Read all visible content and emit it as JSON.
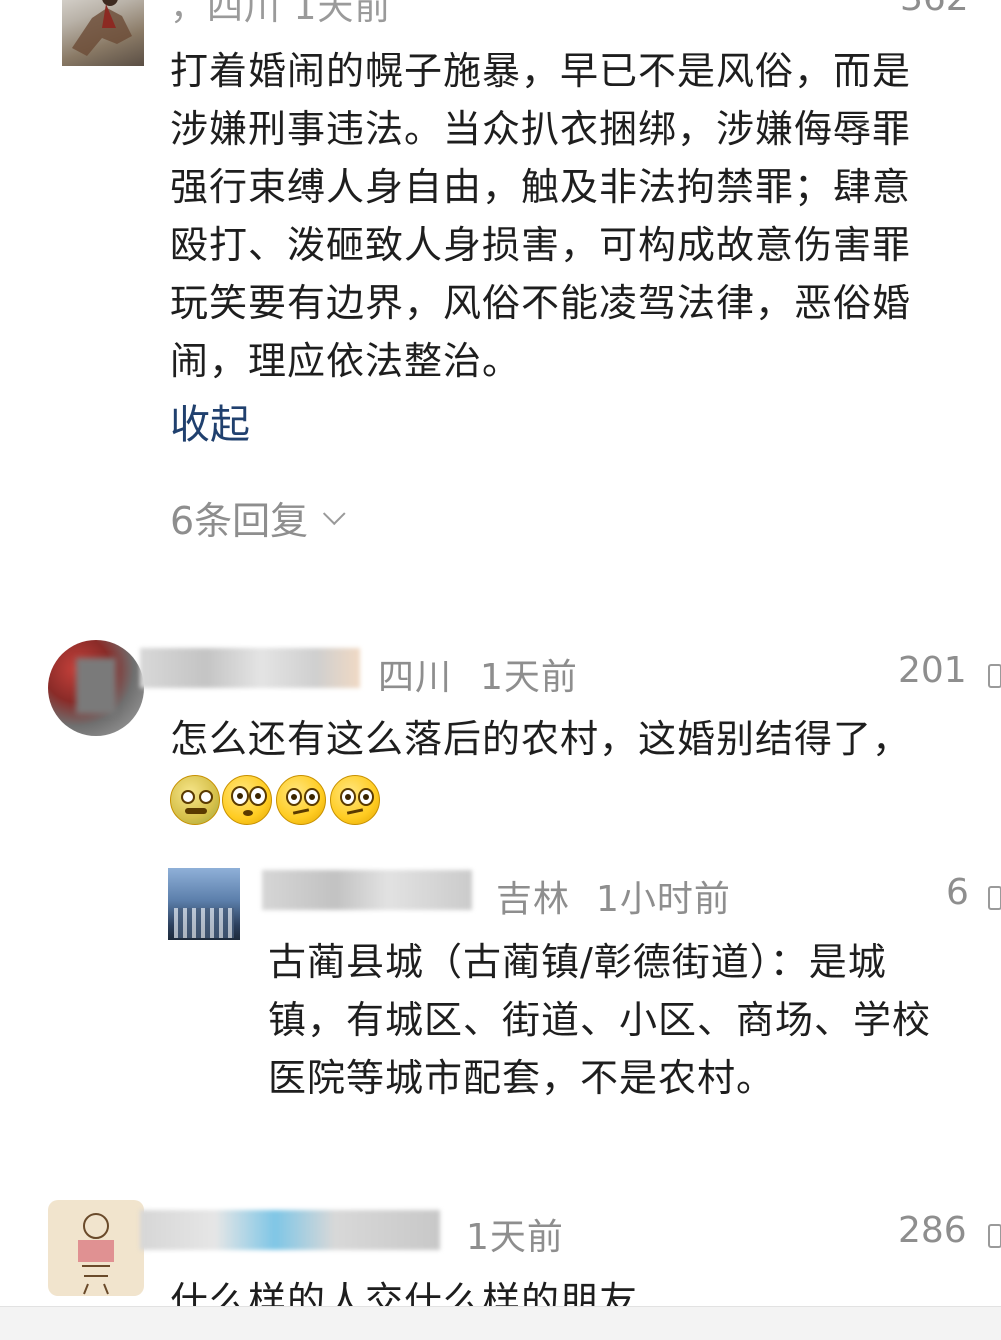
{
  "comment1": {
    "meta_partial": "，四川 1天前",
    "like_count_partial": "362",
    "lines": [
      "打着婚闹的幌子施暴，早已不是风俗，而是",
      "涉嫌刑事违法。当众扒衣捆绑，涉嫌侮辱罪",
      "强行束缚人身自由，触及非法拘禁罪；肆意",
      "殴打、泼砸致人身损害，可构成故意伤害罪",
      "玩笑要有边界，风俗不能凌驾法律，恶俗婚",
      "闹，理应依法整治。"
    ],
    "collapse_label": "收起",
    "replies_label": "6条回复"
  },
  "comment2": {
    "location": "四川",
    "time": "1天前",
    "like_count": "201",
    "text": "怎么还有这么落后的农村，这婚别结得了，",
    "emoji_names": [
      "nauseated-face-icon",
      "flushed-face-icon",
      "thinking-face-icon",
      "thinking-face-icon"
    ]
  },
  "reply1": {
    "location": "吉林",
    "time": "1小时前",
    "like_count": "6",
    "lines": [
      "古蔺县城（古蔺镇/彰德街道）：是城",
      "镇，有城区、街道、小区、商场、学校",
      "医院等城市配套，不是农村。"
    ]
  },
  "comment3": {
    "time": "1天前",
    "like_count": "286",
    "text_partial": "什么样的人交什么样的朋友"
  },
  "colors": {
    "link": "#20406e",
    "meta": "#8e8e8e",
    "body": "#1e1e1e"
  }
}
